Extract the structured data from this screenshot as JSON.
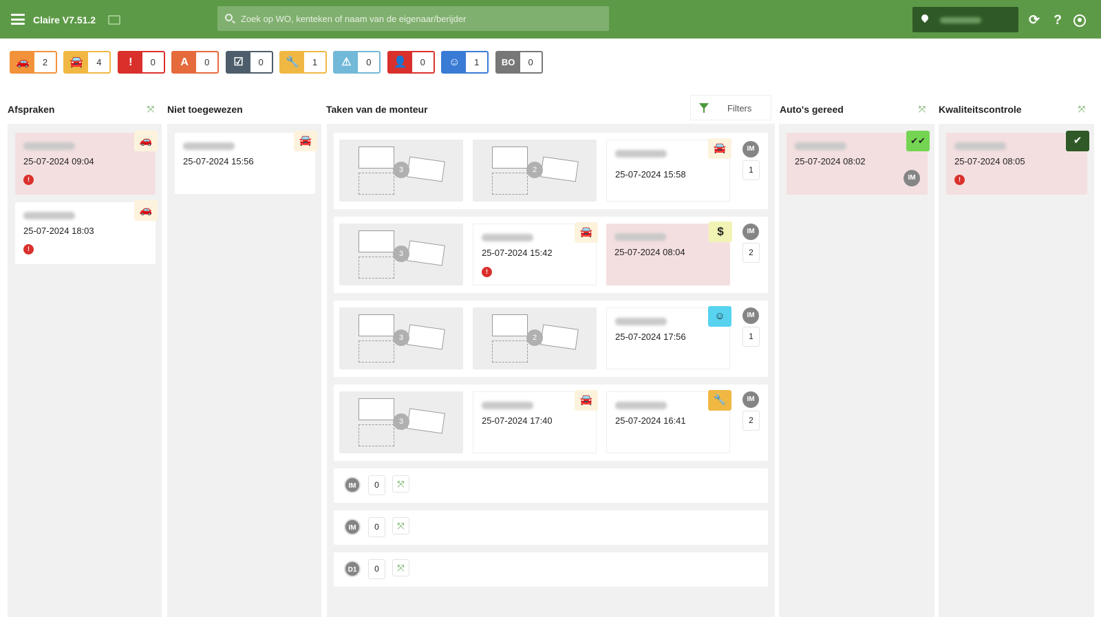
{
  "header": {
    "app_title": "Claire V7.51.2",
    "search_placeholder": "Zoek op WO, kenteken of naam van de eigenaar/berijder",
    "icons": [
      "menu-icon",
      "cast-icon",
      "search-icon",
      "location-pin-icon",
      "refresh-icon",
      "help-icon",
      "user-icon"
    ]
  },
  "status_badges": [
    {
      "icon": "car-icon",
      "glyph": "🚗",
      "count": "2",
      "color": "#f2923a"
    },
    {
      "icon": "car-garage-icon",
      "glyph": "🚘",
      "count": "4",
      "color": "#f0b843"
    },
    {
      "icon": "alert-icon",
      "glyph": "!",
      "count": "0",
      "color": "#d9302c"
    },
    {
      "icon": "letter-a-icon",
      "glyph": "A",
      "count": "0",
      "color": "#e56a3c"
    },
    {
      "icon": "calendar-check-icon",
      "glyph": "☑",
      "count": "0",
      "color": "#4d5d6b"
    },
    {
      "icon": "wrench-icon",
      "glyph": "🔧",
      "count": "1",
      "color": "#f0b843"
    },
    {
      "icon": "warning-icon",
      "glyph": "⚠",
      "count": "0",
      "color": "#72b8d8"
    },
    {
      "icon": "user-check-icon",
      "glyph": "👤",
      "count": "0",
      "color": "#d9302c"
    },
    {
      "icon": "smiley-icon",
      "glyph": "☺",
      "count": "1",
      "color": "#3a7bd5"
    },
    {
      "icon": "bo-icon",
      "glyph": "BO",
      "count": "0",
      "color": "#777777"
    }
  ],
  "columns": {
    "afspraken": {
      "title": "Afspraken",
      "cards": [
        {
          "datetime": "25-07-2024 09:04",
          "icon": "car-icon"
        },
        {
          "datetime": "25-07-2024 18:03",
          "icon": "car-icon"
        }
      ]
    },
    "niet_toegewezen": {
      "title": "Niet toegewezen",
      "cards": [
        {
          "datetime": "25-07-2024 15:56",
          "icon": "car-garage-icon"
        }
      ]
    },
    "taken": {
      "title": "Taken van de monteur",
      "filters_label": "Filters",
      "rows": [
        {
          "placeholders": [
            "3",
            "2"
          ],
          "cards": [
            {
              "datetime": "25-07-2024 15:58",
              "icon": "car-garage-icon"
            }
          ],
          "mechanic": "IM",
          "count": "1"
        },
        {
          "placeholders": [
            "3"
          ],
          "cards": [
            {
              "datetime": "25-07-2024 15:42",
              "icon": "car-garage-icon"
            },
            {
              "datetime": "25-07-2024 08:04",
              "icon": "dollar-icon"
            }
          ],
          "mechanic": "IM",
          "count": "2"
        },
        {
          "placeholders": [
            "3",
            "2"
          ],
          "cards": [
            {
              "datetime": "25-07-2024 17:56",
              "icon": "smiley-icon"
            }
          ],
          "mechanic": "IM",
          "count": "1"
        },
        {
          "placeholders": [
            "3"
          ],
          "cards": [
            {
              "datetime": "25-07-2024 17:40",
              "icon": "car-garage-icon"
            },
            {
              "datetime": "25-07-2024 16:41",
              "icon": "wrench-icon"
            }
          ],
          "mechanic": "IM",
          "count": "2"
        }
      ],
      "empty_rows": [
        {
          "mechanic": "IM",
          "count": "0"
        },
        {
          "mechanic": "IM",
          "count": "0"
        },
        {
          "mechanic": "D1",
          "count": "0"
        }
      ]
    },
    "autos_gereed": {
      "title": "Auto's gereed",
      "cards": [
        {
          "datetime": "25-07-2024 08:02",
          "icon": "double-check-icon",
          "mechanic": "IM"
        }
      ]
    },
    "kwaliteitscontrole": {
      "title": "Kwaliteitscontrole",
      "cards": [
        {
          "datetime": "25-07-2024 08:05",
          "icon": "shield-check-icon"
        }
      ]
    }
  },
  "warning_glyph": "!",
  "collapse_glyph": "⤧"
}
